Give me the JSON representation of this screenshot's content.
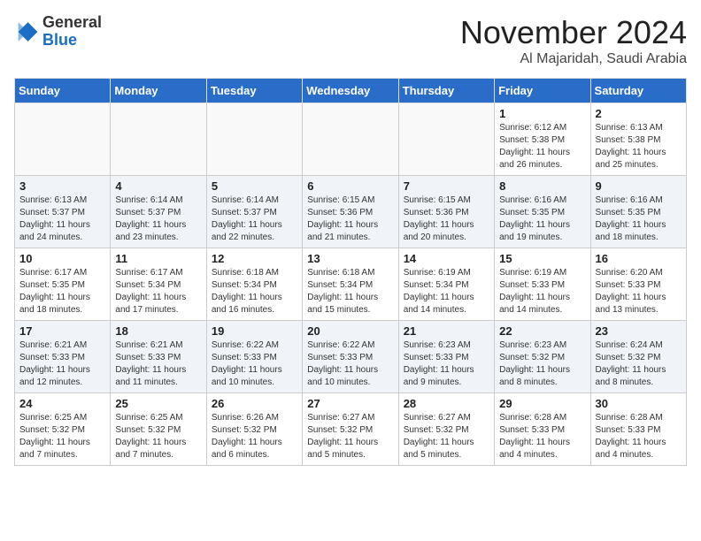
{
  "header": {
    "logo_general": "General",
    "logo_blue": "Blue",
    "month_title": "November 2024",
    "location": "Al Majaridah, Saudi Arabia"
  },
  "weekdays": [
    "Sunday",
    "Monday",
    "Tuesday",
    "Wednesday",
    "Thursday",
    "Friday",
    "Saturday"
  ],
  "weeks": [
    [
      {
        "day": "",
        "info": ""
      },
      {
        "day": "",
        "info": ""
      },
      {
        "day": "",
        "info": ""
      },
      {
        "day": "",
        "info": ""
      },
      {
        "day": "",
        "info": ""
      },
      {
        "day": "1",
        "info": "Sunrise: 6:12 AM\nSunset: 5:38 PM\nDaylight: 11 hours and 26 minutes."
      },
      {
        "day": "2",
        "info": "Sunrise: 6:13 AM\nSunset: 5:38 PM\nDaylight: 11 hours and 25 minutes."
      }
    ],
    [
      {
        "day": "3",
        "info": "Sunrise: 6:13 AM\nSunset: 5:37 PM\nDaylight: 11 hours and 24 minutes."
      },
      {
        "day": "4",
        "info": "Sunrise: 6:14 AM\nSunset: 5:37 PM\nDaylight: 11 hours and 23 minutes."
      },
      {
        "day": "5",
        "info": "Sunrise: 6:14 AM\nSunset: 5:37 PM\nDaylight: 11 hours and 22 minutes."
      },
      {
        "day": "6",
        "info": "Sunrise: 6:15 AM\nSunset: 5:36 PM\nDaylight: 11 hours and 21 minutes."
      },
      {
        "day": "7",
        "info": "Sunrise: 6:15 AM\nSunset: 5:36 PM\nDaylight: 11 hours and 20 minutes."
      },
      {
        "day": "8",
        "info": "Sunrise: 6:16 AM\nSunset: 5:35 PM\nDaylight: 11 hours and 19 minutes."
      },
      {
        "day": "9",
        "info": "Sunrise: 6:16 AM\nSunset: 5:35 PM\nDaylight: 11 hours and 18 minutes."
      }
    ],
    [
      {
        "day": "10",
        "info": "Sunrise: 6:17 AM\nSunset: 5:35 PM\nDaylight: 11 hours and 18 minutes."
      },
      {
        "day": "11",
        "info": "Sunrise: 6:17 AM\nSunset: 5:34 PM\nDaylight: 11 hours and 17 minutes."
      },
      {
        "day": "12",
        "info": "Sunrise: 6:18 AM\nSunset: 5:34 PM\nDaylight: 11 hours and 16 minutes."
      },
      {
        "day": "13",
        "info": "Sunrise: 6:18 AM\nSunset: 5:34 PM\nDaylight: 11 hours and 15 minutes."
      },
      {
        "day": "14",
        "info": "Sunrise: 6:19 AM\nSunset: 5:34 PM\nDaylight: 11 hours and 14 minutes."
      },
      {
        "day": "15",
        "info": "Sunrise: 6:19 AM\nSunset: 5:33 PM\nDaylight: 11 hours and 14 minutes."
      },
      {
        "day": "16",
        "info": "Sunrise: 6:20 AM\nSunset: 5:33 PM\nDaylight: 11 hours and 13 minutes."
      }
    ],
    [
      {
        "day": "17",
        "info": "Sunrise: 6:21 AM\nSunset: 5:33 PM\nDaylight: 11 hours and 12 minutes."
      },
      {
        "day": "18",
        "info": "Sunrise: 6:21 AM\nSunset: 5:33 PM\nDaylight: 11 hours and 11 minutes."
      },
      {
        "day": "19",
        "info": "Sunrise: 6:22 AM\nSunset: 5:33 PM\nDaylight: 11 hours and 10 minutes."
      },
      {
        "day": "20",
        "info": "Sunrise: 6:22 AM\nSunset: 5:33 PM\nDaylight: 11 hours and 10 minutes."
      },
      {
        "day": "21",
        "info": "Sunrise: 6:23 AM\nSunset: 5:33 PM\nDaylight: 11 hours and 9 minutes."
      },
      {
        "day": "22",
        "info": "Sunrise: 6:23 AM\nSunset: 5:32 PM\nDaylight: 11 hours and 8 minutes."
      },
      {
        "day": "23",
        "info": "Sunrise: 6:24 AM\nSunset: 5:32 PM\nDaylight: 11 hours and 8 minutes."
      }
    ],
    [
      {
        "day": "24",
        "info": "Sunrise: 6:25 AM\nSunset: 5:32 PM\nDaylight: 11 hours and 7 minutes."
      },
      {
        "day": "25",
        "info": "Sunrise: 6:25 AM\nSunset: 5:32 PM\nDaylight: 11 hours and 7 minutes."
      },
      {
        "day": "26",
        "info": "Sunrise: 6:26 AM\nSunset: 5:32 PM\nDaylight: 11 hours and 6 minutes."
      },
      {
        "day": "27",
        "info": "Sunrise: 6:27 AM\nSunset: 5:32 PM\nDaylight: 11 hours and 5 minutes."
      },
      {
        "day": "28",
        "info": "Sunrise: 6:27 AM\nSunset: 5:32 PM\nDaylight: 11 hours and 5 minutes."
      },
      {
        "day": "29",
        "info": "Sunrise: 6:28 AM\nSunset: 5:33 PM\nDaylight: 11 hours and 4 minutes."
      },
      {
        "day": "30",
        "info": "Sunrise: 6:28 AM\nSunset: 5:33 PM\nDaylight: 11 hours and 4 minutes."
      }
    ]
  ]
}
